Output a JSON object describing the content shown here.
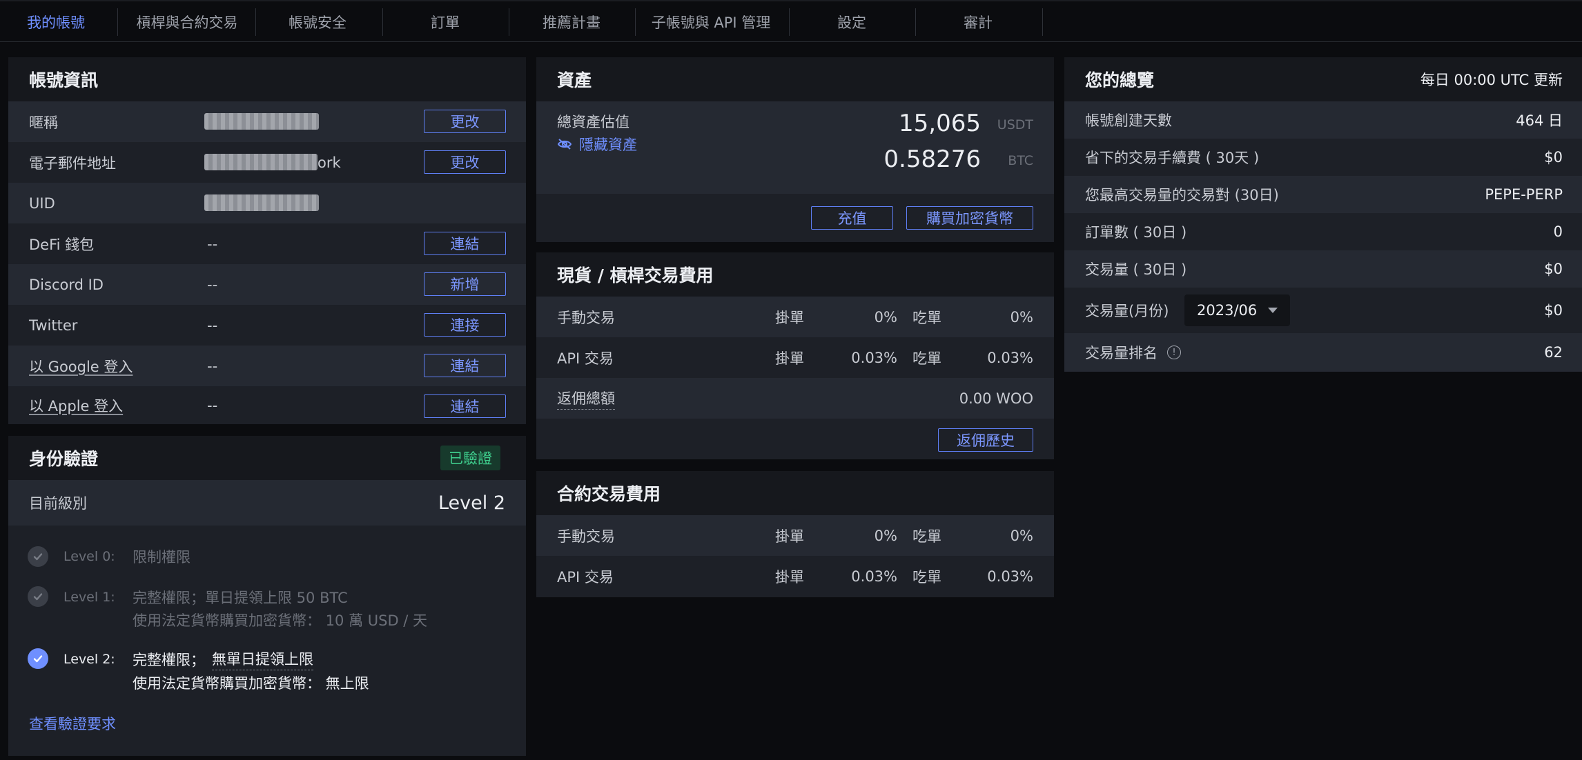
{
  "nav": {
    "tabs": [
      {
        "label": "我的帳號",
        "active": true
      },
      {
        "label": "槓桿與合約交易"
      },
      {
        "label": "帳號安全"
      },
      {
        "label": "訂單"
      },
      {
        "label": "推薦計畫"
      },
      {
        "label": "子帳號與 API 管理"
      },
      {
        "label": "設定"
      },
      {
        "label": "審計"
      }
    ]
  },
  "account": {
    "title": "帳號資訊",
    "rows": [
      {
        "label": "暱稱",
        "value": "",
        "action": "更改"
      },
      {
        "label": "電子郵件地址",
        "value": "ork",
        "action": "更改"
      },
      {
        "label": "UID",
        "value": "",
        "action": ""
      },
      {
        "label": "DeFi 錢包",
        "value": "--",
        "action": "連結"
      },
      {
        "label": "Discord ID",
        "value": "--",
        "action": "新增"
      },
      {
        "label": "Twitter",
        "value": "--",
        "action": "連接"
      },
      {
        "label": "以 Google 登入",
        "value": "--",
        "action": "連結"
      },
      {
        "label": "以 Apple 登入",
        "value": "--",
        "action": "連結"
      }
    ]
  },
  "verification": {
    "title": "身份驗證",
    "badge": "已驗證",
    "current_label": "目前級別",
    "current_value": "Level 2",
    "levels": [
      {
        "name": "Level 0:",
        "line1": "限制權限",
        "line2": ""
      },
      {
        "name": "Level 1:",
        "line1": "完整權限；單日提領上限 50 BTC",
        "line2": "使用法定貨幣購買加密貨幣：  10 萬 USD / 天"
      },
      {
        "name": "Level 2:",
        "line1a": "完整權限；",
        "line1b": "無單日提領上限",
        "line2": "使用法定貨幣購買加密貨幣：  無上限"
      }
    ],
    "link": "查看驗證要求"
  },
  "assets": {
    "title": "資產",
    "estimate_label": "總資產估值",
    "hide_label": "隱藏資產",
    "usdt_value": "15,065",
    "usdt_unit": "USDT",
    "btc_value": "0.58276",
    "btc_unit": "BTC",
    "deposit_btn": "充值",
    "buy_btn": "購買加密貨幣"
  },
  "spot_fees": {
    "title": "現貨 / 槓桿交易費用",
    "rows": [
      {
        "label": "手動交易",
        "maker_label": "掛單",
        "maker": "0%",
        "taker_label": "吃單",
        "taker": "0%"
      },
      {
        "label": "API 交易",
        "maker_label": "掛單",
        "maker": "0.03%",
        "taker_label": "吃單",
        "taker": "0.03%"
      }
    ],
    "rebate_label": "返佣總額",
    "rebate_value": "0.00 WOO",
    "history_btn": "返佣歷史"
  },
  "futures_fees": {
    "title": "合約交易費用",
    "rows": [
      {
        "label": "手動交易",
        "maker_label": "掛單",
        "maker": "0%",
        "taker_label": "吃單",
        "taker": "0%"
      },
      {
        "label": "API 交易",
        "maker_label": "掛單",
        "maker": "0.03%",
        "taker_label": "吃單",
        "taker": "0.03%"
      }
    ]
  },
  "overview": {
    "title": "您的總覽",
    "update_note": "每日 00:00 UTC 更新",
    "rows": [
      {
        "label": "帳號創建天數",
        "value": "464 日"
      },
      {
        "label": "省下的交易手續費 ( 30天 )",
        "value": "$0"
      },
      {
        "label": "您最高交易量的交易對 (30日)",
        "value": "PEPE-PERP"
      },
      {
        "label": "訂單數 ( 30日 )",
        "value": "0"
      },
      {
        "label": "交易量 ( 30日 )",
        "value": "$0"
      },
      {
        "label": "交易量(月份)",
        "value": "$0"
      },
      {
        "label": "交易量排名",
        "value": "62"
      }
    ],
    "month_select": "2023/06"
  }
}
